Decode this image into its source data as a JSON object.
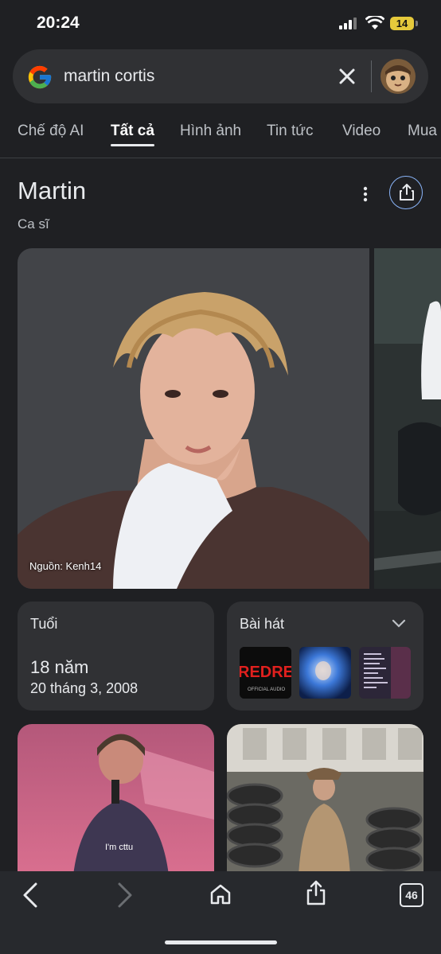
{
  "status_bar": {
    "time": "20:24",
    "battery": "14"
  },
  "search": {
    "query": "martin cortis"
  },
  "tabs": [
    {
      "label": "Chế độ AI"
    },
    {
      "label": "Tất cả"
    },
    {
      "label": "Hình ảnh"
    },
    {
      "label": "Tin tức"
    },
    {
      "label": "Video"
    },
    {
      "label": "Mua"
    }
  ],
  "knowledge_panel": {
    "title": "Martin",
    "subtitle": "Ca sĩ",
    "image_source": "Nguồn: Kenh14",
    "age_card": {
      "label": "Tuổi",
      "value": "18 năm",
      "birthdate": "20 tháng 3, 2008"
    },
    "songs_card": {
      "label": "Bài hát",
      "thumb1_text": "REDRE",
      "thumb1_caption": "OFFICIAL AUDIO"
    },
    "tile1_caption": "I'm cttu"
  },
  "browser": {
    "tab_count": "46"
  },
  "colors": {
    "background": "#1f2023",
    "card": "#303134",
    "accent": "#8ab4f8"
  },
  "icons": [
    "google-logo-icon",
    "close-icon",
    "more-vert-icon",
    "share-icon",
    "chevron-down-icon",
    "back-icon",
    "forward-icon",
    "home-icon",
    "share-up-icon",
    "tabs-icon"
  ]
}
